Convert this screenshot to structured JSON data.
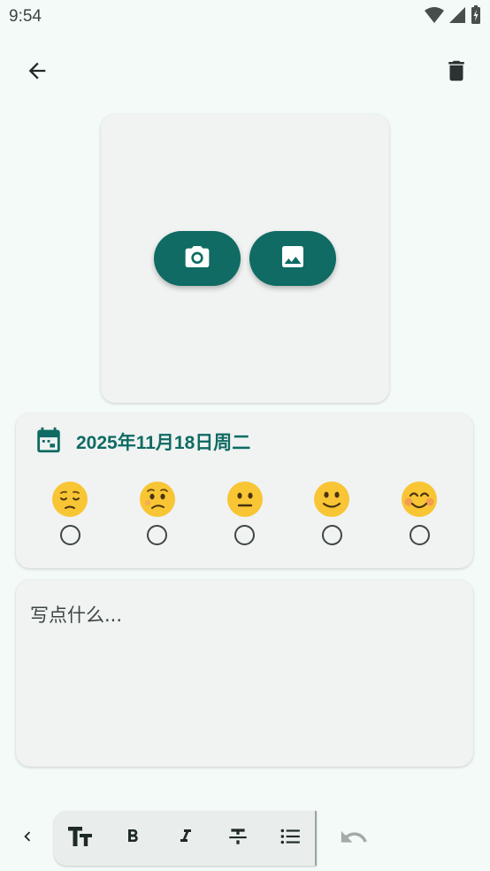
{
  "status_bar": {
    "time": "9:54"
  },
  "top_bar": {
    "back_icon": "arrow-back-icon",
    "delete_icon": "trash-icon"
  },
  "photo": {
    "camera_icon": "camera-icon",
    "gallery_icon": "image-icon"
  },
  "entry": {
    "date": "2025年11月18日周二",
    "moods": [
      {
        "name": "very-sad",
        "emoji": "😔"
      },
      {
        "name": "sad",
        "emoji": "😟"
      },
      {
        "name": "neutral",
        "emoji": "😐"
      },
      {
        "name": "happy",
        "emoji": "🙂"
      },
      {
        "name": "very-happy",
        "emoji": "😊"
      }
    ]
  },
  "note": {
    "placeholder": "写点什么...",
    "value": ""
  },
  "toolbar": {
    "tools": [
      "text-size-icon",
      "bold-icon",
      "italic-icon",
      "strikethrough-icon",
      "bullet-list-icon"
    ],
    "undo_icon": "undo-icon"
  },
  "colors": {
    "accent": "#0f6b63",
    "background": "#f3faf7",
    "card": "#f0f3f2",
    "emoji": "#f8c534"
  }
}
